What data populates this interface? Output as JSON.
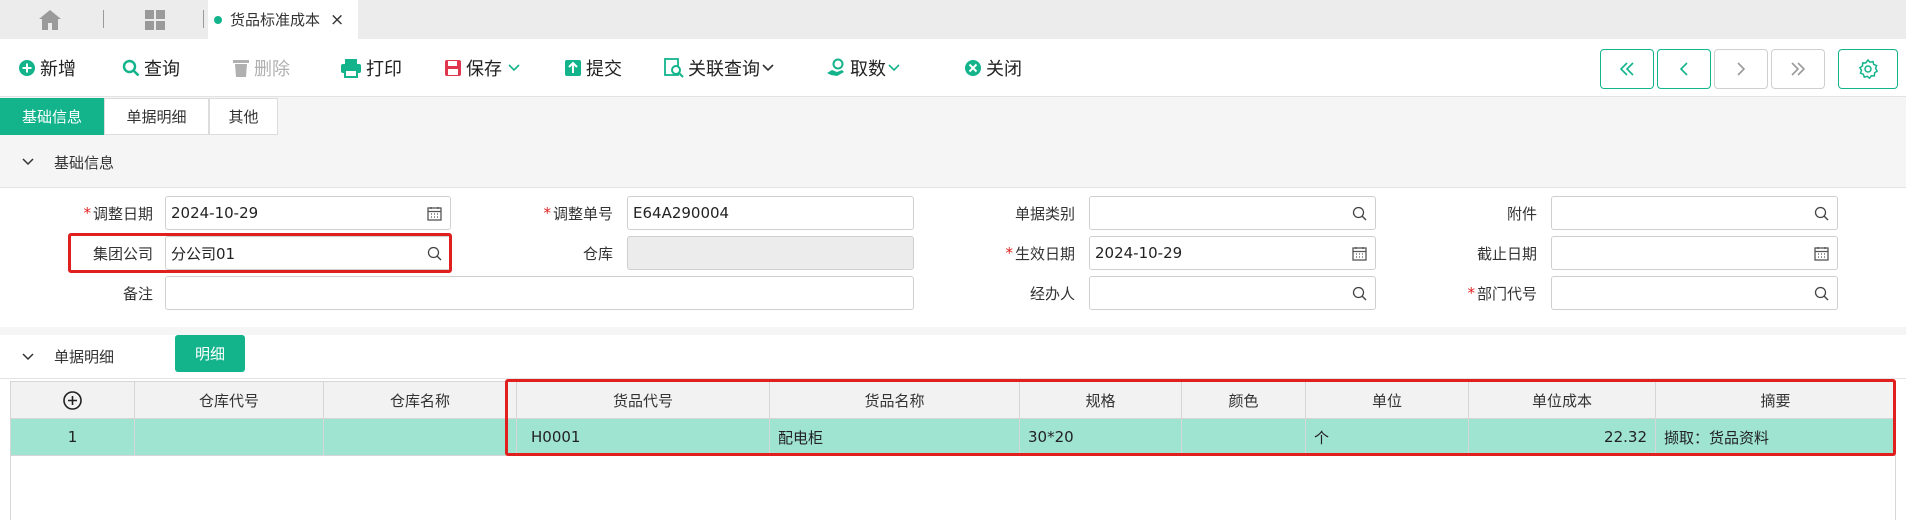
{
  "window_tabs": {
    "active_tab": {
      "label": "货品标准成本",
      "close_glyph": "×"
    }
  },
  "toolbar": {
    "add": "新增",
    "query": "查询",
    "delete": "删除",
    "print": "打印",
    "save": "保存",
    "submit": "提交",
    "related_query": "关联查询",
    "fetch": "取数",
    "close": "关闭"
  },
  "subtabs": [
    "基础信息",
    "单据明细",
    "其他"
  ],
  "sections": {
    "basic": "基础信息",
    "detail": "单据明细",
    "detail_button": "明细"
  },
  "form": {
    "adjust_date": {
      "label": "调整日期",
      "value": "2024-10-29"
    },
    "adjust_no": {
      "label": "调整单号",
      "value": "E64A290004"
    },
    "doc_type": {
      "label": "单据类别",
      "value": ""
    },
    "attachment": {
      "label": "附件",
      "value": ""
    },
    "group_company": {
      "label": "集团公司",
      "value": "分公司01"
    },
    "warehouse": {
      "label": "仓库",
      "value": ""
    },
    "effective_date": {
      "label": "生效日期",
      "value": "2024-10-29"
    },
    "end_date": {
      "label": "截止日期",
      "value": ""
    },
    "remark": {
      "label": "备注",
      "value": ""
    },
    "handler": {
      "label": "经办人",
      "value": ""
    },
    "dept_code": {
      "label": "部门代号",
      "value": ""
    }
  },
  "grid": {
    "columns": [
      "仓库代号",
      "仓库名称",
      "货品代号",
      "货品名称",
      "规格",
      "颜色",
      "单位",
      "单位成本",
      "摘要"
    ],
    "rows": [
      {
        "index": "1",
        "wh_code": "",
        "wh_name": "",
        "item_code": "H0001",
        "item_name": "配电柜",
        "spec": "30*20",
        "color": "",
        "unit": "个",
        "unit_cost": "22.32",
        "summary": "撷取：货品资料"
      }
    ]
  },
  "colors": {
    "accent": "#13b48c",
    "highlight": "#e01f1f",
    "row_selected": "#9fe3d1"
  }
}
